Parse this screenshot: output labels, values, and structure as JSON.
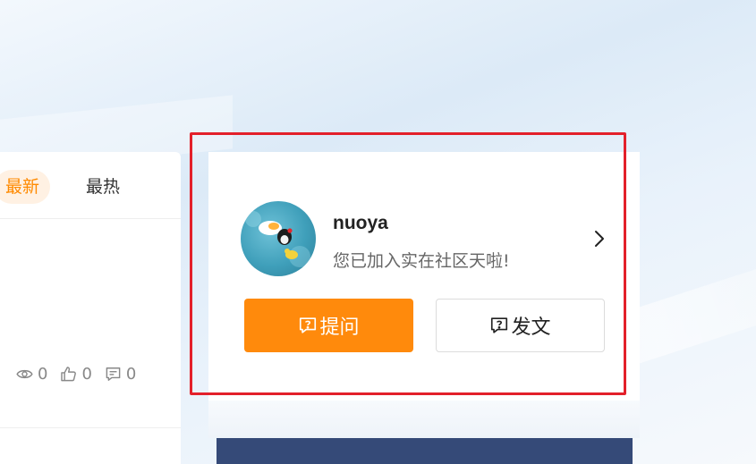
{
  "tabs": {
    "latest": "最新",
    "hot": "最热"
  },
  "stats": {
    "views": "0",
    "likes": "0",
    "comments": "0"
  },
  "profile": {
    "username": "nuoya",
    "welcome": "您已加入实在社区天啦!",
    "ask_label": "提问",
    "post_label": "发文"
  },
  "colors": {
    "accent": "#ff8a0c",
    "highlight": "#e3202a",
    "panel": "#354a78"
  }
}
